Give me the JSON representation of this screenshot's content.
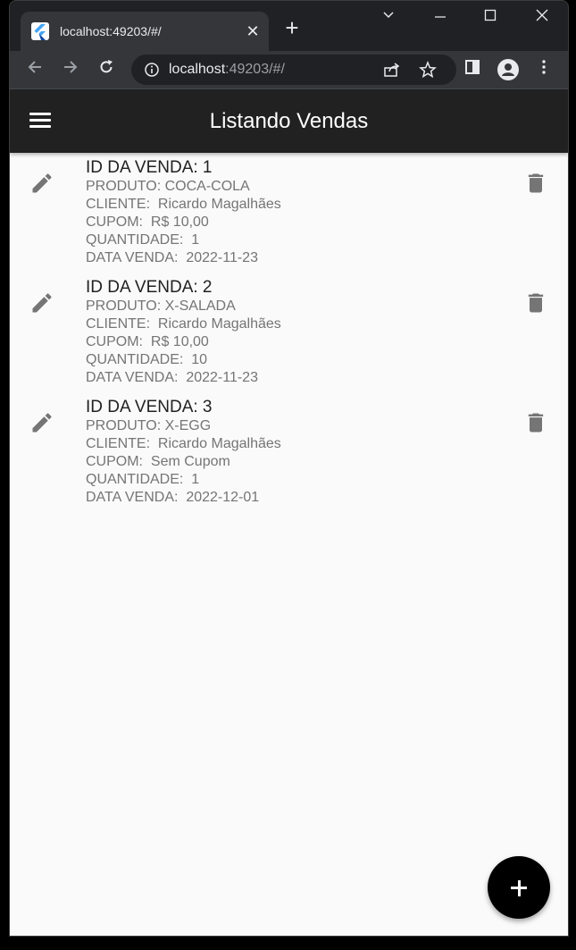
{
  "browser": {
    "tab_title": "localhost:49203/#/",
    "url_host": "localhost",
    "url_rest": ":49203/#/"
  },
  "app": {
    "title": "Listando Vendas"
  },
  "labels": {
    "produto": "PRODUTO: ",
    "cliente": "CLIENTE:  ",
    "cupom": "CUPOM:  ",
    "quantidade": "QUANTIDADE:  ",
    "data": "DATA VENDA:  "
  },
  "vendas": [
    {
      "title": "ID DA VENDA: 1",
      "produto": "PRODUTO: COCA-COLA",
      "cliente": "CLIENTE:  Ricardo Magalhães",
      "cupom": "CUPOM:  R$ 10,00",
      "quantidade": "QUANTIDADE:  1",
      "data": "DATA VENDA:  2022-11-23"
    },
    {
      "title": "ID DA VENDA: 2",
      "produto": "PRODUTO: X-SALADA",
      "cliente": "CLIENTE:  Ricardo Magalhães",
      "cupom": "CUPOM:  R$ 10,00",
      "quantidade": "QUANTIDADE:  10",
      "data": "DATA VENDA:  2022-11-23"
    },
    {
      "title": "ID DA VENDA: 3",
      "produto": "PRODUTO: X-EGG",
      "cliente": "CLIENTE:  Ricardo Magalhães",
      "cupom": "CUPOM:  Sem Cupom",
      "quantidade": "QUANTIDADE:  1",
      "data": "DATA VENDA:  2022-12-01"
    }
  ],
  "icons": {
    "menu": "menu-icon",
    "edit": "pencil-icon",
    "delete": "trash-icon",
    "add": "plus-icon"
  },
  "colors": {
    "appbar": "#212121",
    "background": "#fafafa",
    "icon": "#757575",
    "fab": "#000000"
  }
}
